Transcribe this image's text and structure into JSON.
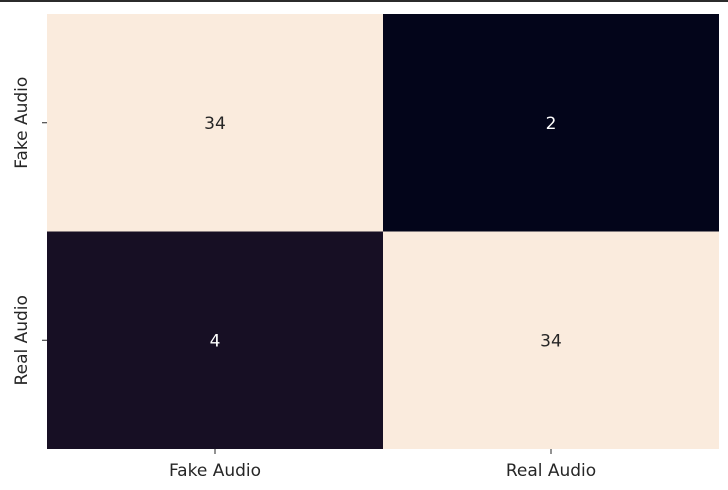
{
  "chart_data": {
    "type": "heatmap",
    "title": "",
    "xlabel": "",
    "ylabel": "",
    "x_categories": [
      "Fake Audio",
      "Real Audio"
    ],
    "y_categories": [
      "Fake Audio",
      "Real Audio"
    ],
    "values": [
      [
        34,
        2
      ],
      [
        4,
        34
      ]
    ],
    "value_range": [
      2,
      34
    ],
    "colormap": "rocket",
    "colorbar": false,
    "annotations": true,
    "colors": {
      "low": "#03051a",
      "mid_low": "#1d1227",
      "high": "#faebdd",
      "text_on_light": "#262626",
      "text_on_dark": "#ffffff"
    }
  }
}
